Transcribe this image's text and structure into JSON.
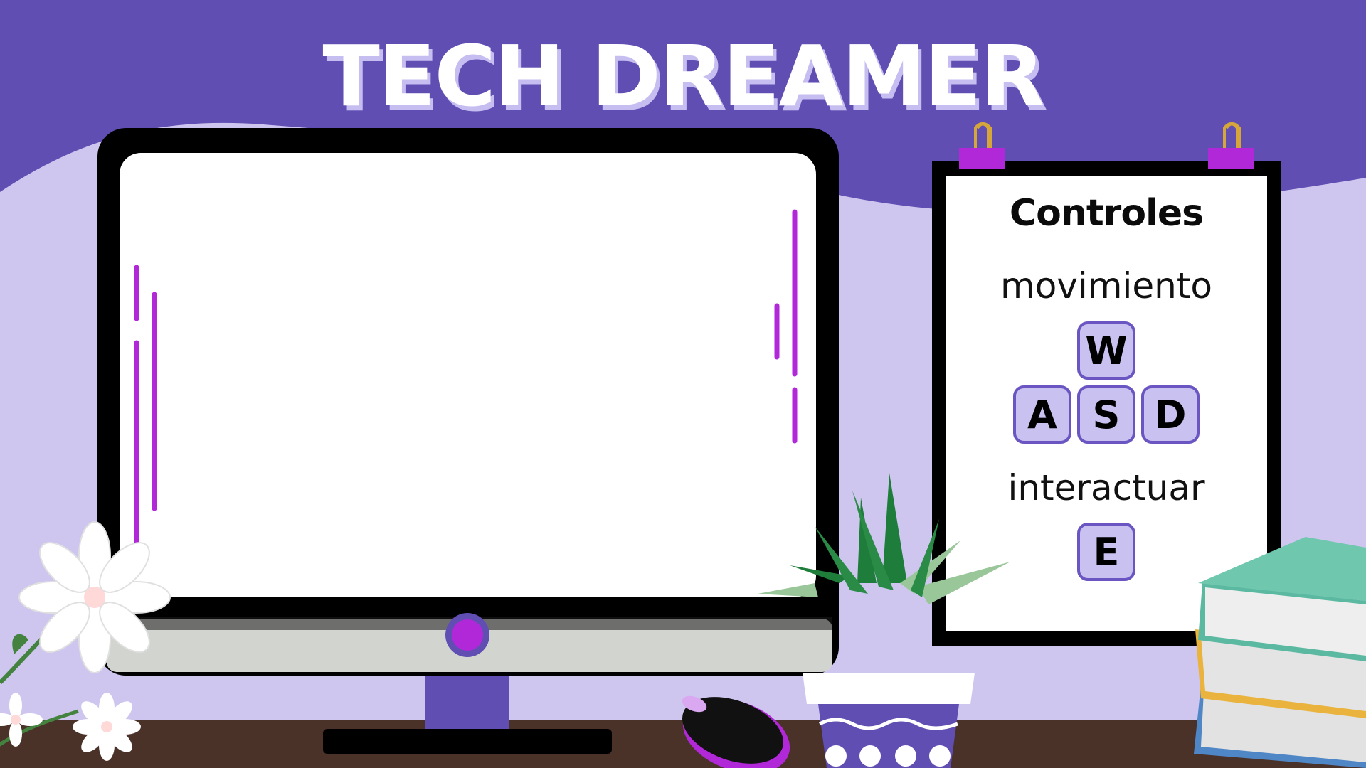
{
  "game": {
    "title": "TECH DREAMER"
  },
  "controls_board": {
    "heading": "Controles",
    "movement_label": "movimiento",
    "movement_keys": [
      "W",
      "A",
      "S",
      "D"
    ],
    "interact_label": "interactuar",
    "interact_key": "E"
  },
  "colors": {
    "background": "#604eb3",
    "wall": "#cfc6ef",
    "desk": "#4a3229",
    "accent": "#b128d8",
    "key_fill": "#c9c1ef",
    "key_border": "#6a55c2"
  }
}
